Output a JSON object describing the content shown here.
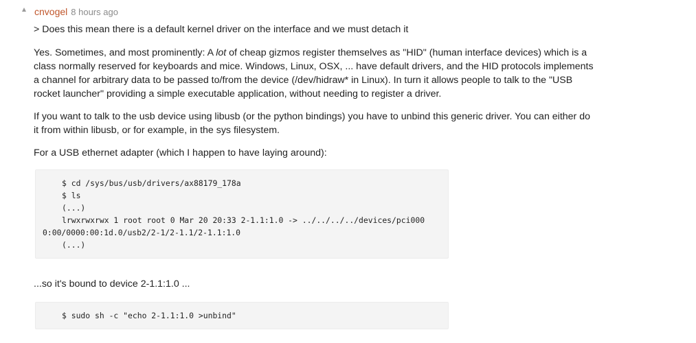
{
  "comment": {
    "author": "cnvogel",
    "timestamp": "8 hours ago",
    "quote": "> Does this mean there is a default kernel driver on the interface and we must detach it",
    "para1": {
      "before": "Yes. Sometimes, and most prominently: A ",
      "emphasis": "lot",
      "after_line1": " of cheap gizmos register themselves as \"HID\" (human interface devices) which is a",
      "line2": "class normally reserved for keyboards and mice. Windows, Linux, OSX, ... have default drivers, and the HID protocols implements",
      "line3": "a channel for arbitrary data to be passed to/from the device (/dev/hidraw* in Linux). In turn it allows people to talk to the \"USB",
      "line4": "rocket launcher\" providing a simple executable application, without needing to register a driver."
    },
    "para2": {
      "line1": "If you want to talk to the usb device using libusb (or the python bindings) you have to unbind this generic driver. You can either do",
      "line2": "it from within libusb, or for example, in the sys filesystem."
    },
    "para3": "For a USB ethernet adapter (which I happen to have laying around):",
    "code1": [
      "$ cd /sys/bus/usb/drivers/ax88179_178a",
      "$ ls",
      "(...)",
      "lrwxrwxrwx 1 root root 0 Mar 20 20:33 2-1.1:1.0 -> ../../../../devices/pci000",
      "0:00/0000:00:1d.0/usb2/2-1/2-1.1/2-1.1:1.0",
      "(...)"
    ],
    "para4": "...so it's bound to device 2-1.1:1.0 ...",
    "code2": [
      "$ sudo sh -c \"echo 2-1.1:1.0 >unbind\""
    ]
  }
}
